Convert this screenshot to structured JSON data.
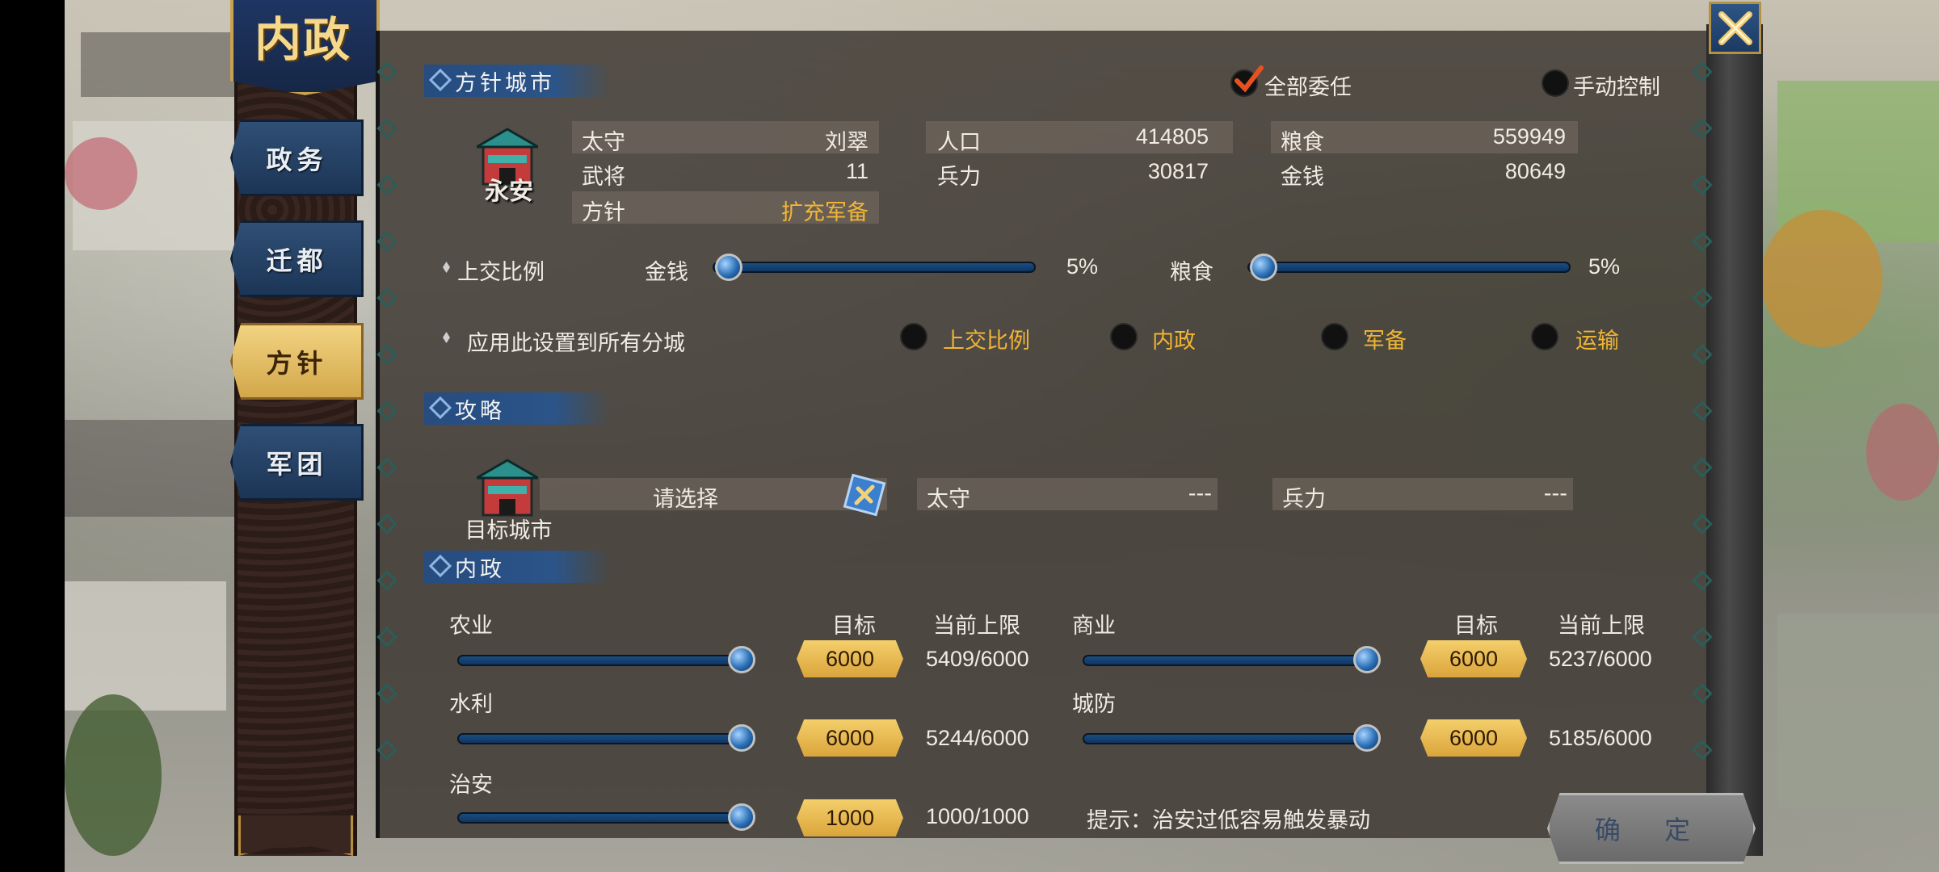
{
  "banner": {
    "title": "内政"
  },
  "side_tabs": [
    {
      "label": "政务"
    },
    {
      "label": "迁都"
    },
    {
      "label": "方针"
    },
    {
      "label": "军团"
    }
  ],
  "policy_city": {
    "section_title": "方针城市",
    "city_name": "永安",
    "delegate_all_label": "全部委任",
    "manual_control_label": "手动控制",
    "fields": {
      "governor_label": "太守",
      "governor_value": "刘翠",
      "generals_label": "武将",
      "generals_value": "11",
      "policy_label": "方针",
      "policy_value": "扩充军备",
      "population_label": "人口",
      "population_value": "414805",
      "troops_label": "兵力",
      "troops_value": "30817",
      "food_label": "粮食",
      "food_value": "559949",
      "money_label": "金钱",
      "money_value": "80649"
    },
    "tribute": {
      "label": "上交比例",
      "money_label": "金钱",
      "money_percent": "5%",
      "money_fraction": 0.05,
      "food_label": "粮食",
      "food_percent": "5%",
      "food_fraction": 0.05
    },
    "apply_all": {
      "label": "应用此设置到所有分城",
      "options": [
        "上交比例",
        "内政",
        "军备",
        "运输"
      ]
    }
  },
  "strategy": {
    "section_title": "攻略",
    "target_city_label": "目标城市",
    "select_placeholder": "请选择",
    "governor_label": "太守",
    "governor_value": "---",
    "troops_label": "兵力",
    "troops_value": "---"
  },
  "domestic": {
    "section_title": "内政",
    "target_header": "目标",
    "cap_header": "当前上限",
    "items": [
      {
        "label": "农业",
        "target": "6000",
        "current": "5409/6000",
        "fraction": 1.0
      },
      {
        "label": "商业",
        "target": "6000",
        "current": "5237/6000",
        "fraction": 1.0
      },
      {
        "label": "水利",
        "target": "6000",
        "current": "5244/6000",
        "fraction": 1.0
      },
      {
        "label": "城防",
        "target": "6000",
        "current": "5185/6000",
        "fraction": 1.0
      },
      {
        "label": "治安",
        "target": "1000",
        "current": "1000/1000",
        "fraction": 1.0
      }
    ],
    "hint": "提示：治安过低容易触发暴动"
  },
  "confirm_label": "确 定",
  "colors": {
    "accent_orange": "#f1b535",
    "panel_blue": "#264c80",
    "gold": "#c9a24f"
  }
}
